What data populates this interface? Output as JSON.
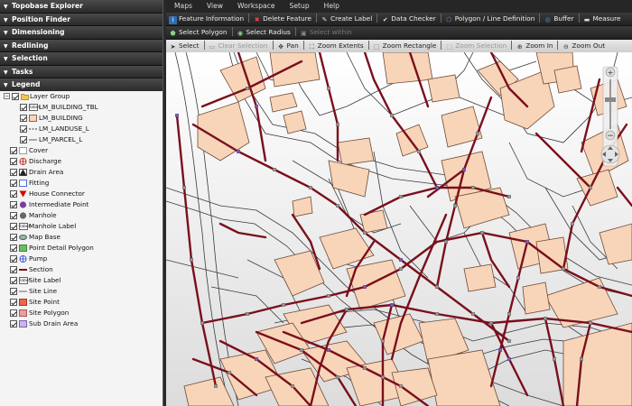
{
  "accordion": [
    "Topobase Explorer",
    "Position Finder",
    "Dimensioning",
    "Redlining",
    "Selection",
    "Tasks",
    "Legend"
  ],
  "legend": {
    "group_label": "Layer Group",
    "group_items": [
      {
        "label": "LM_BUILDING_TBL",
        "icon": "label-icon"
      },
      {
        "label": "LM_BUILDING",
        "icon": "polygon-fill-icon"
      },
      {
        "label": "LM_LANDUSE_L",
        "icon": "dashed-line-icon"
      },
      {
        "label": "LM_PARCEL_L",
        "icon": "thin-line-icon"
      }
    ],
    "items": [
      {
        "label": "Cover",
        "icon": "cover-icon"
      },
      {
        "label": "Discharge",
        "icon": "discharge-icon"
      },
      {
        "label": "Drain Area",
        "icon": "drain-area-icon"
      },
      {
        "label": "Fitting",
        "icon": "fitting-icon"
      },
      {
        "label": "House Connector",
        "icon": "house-connector-icon"
      },
      {
        "label": "Intermediate Point",
        "icon": "intermediate-point-icon"
      },
      {
        "label": "Manhole",
        "icon": "manhole-icon"
      },
      {
        "label": "Manhole Label",
        "icon": "label-icon"
      },
      {
        "label": "Map Base",
        "icon": "map-base-icon"
      },
      {
        "label": "Point Detail Polygon",
        "icon": "point-detail-polygon-icon"
      },
      {
        "label": "Pump",
        "icon": "pump-icon"
      },
      {
        "label": "Section",
        "icon": "section-line-icon"
      },
      {
        "label": "Site Label",
        "icon": "label-icon"
      },
      {
        "label": "Site Line",
        "icon": "site-line-icon"
      },
      {
        "label": "Site Point",
        "icon": "site-point-icon"
      },
      {
        "label": "Site Polygon",
        "icon": "site-polygon-icon"
      },
      {
        "label": "Sub Drain Area",
        "icon": "sub-drain-area-icon"
      }
    ],
    "label_icon_text": "label"
  },
  "menu": [
    "Maps",
    "View",
    "Workspace",
    "Setup",
    "Help"
  ],
  "toolbar1": [
    {
      "label": "Feature Information",
      "icon": "info-icon"
    },
    {
      "label": "Delete Feature",
      "icon": "delete-icon"
    },
    {
      "label": "Create Label",
      "icon": "label-create-icon"
    },
    {
      "label": "Data Checker",
      "icon": "check-icon"
    },
    {
      "label": "Polygon / Line Definition",
      "icon": "polygon-definition-icon"
    },
    {
      "label": "Buffer",
      "icon": "buffer-icon"
    },
    {
      "label": "Measure",
      "icon": "measure-icon"
    }
  ],
  "toolbar2": [
    {
      "label": "Select Polygon",
      "icon": "select-polygon-icon",
      "enabled": true
    },
    {
      "label": "Select Radius",
      "icon": "select-radius-icon",
      "enabled": true
    },
    {
      "label": "Select within",
      "icon": "select-within-icon",
      "enabled": false
    }
  ],
  "toolbar3": [
    {
      "label": "Select",
      "icon": "select-arrow-icon",
      "enabled": true
    },
    {
      "label": "Clear Selection",
      "icon": "clear-selection-icon",
      "enabled": false
    },
    {
      "label": "Pan",
      "icon": "pan-icon",
      "enabled": true
    },
    {
      "label": "Zoom Extents",
      "icon": "zoom-extents-icon",
      "enabled": true
    },
    {
      "label": "Zoom Rectangle",
      "icon": "zoom-rectangle-icon",
      "enabled": true
    },
    {
      "label": "Zoom Selection",
      "icon": "zoom-selection-icon",
      "enabled": false
    },
    {
      "label": "Zoom In",
      "icon": "zoom-in-icon",
      "enabled": true
    },
    {
      "label": "Zoom Out",
      "icon": "zoom-out-icon",
      "enabled": true
    }
  ],
  "colors": {
    "building": "#f8d5b8",
    "building_outline": "#6e4a3a",
    "section_line": "#7a0f1c",
    "parcel_line": "#333333",
    "manhole": "#7b5cc4"
  }
}
